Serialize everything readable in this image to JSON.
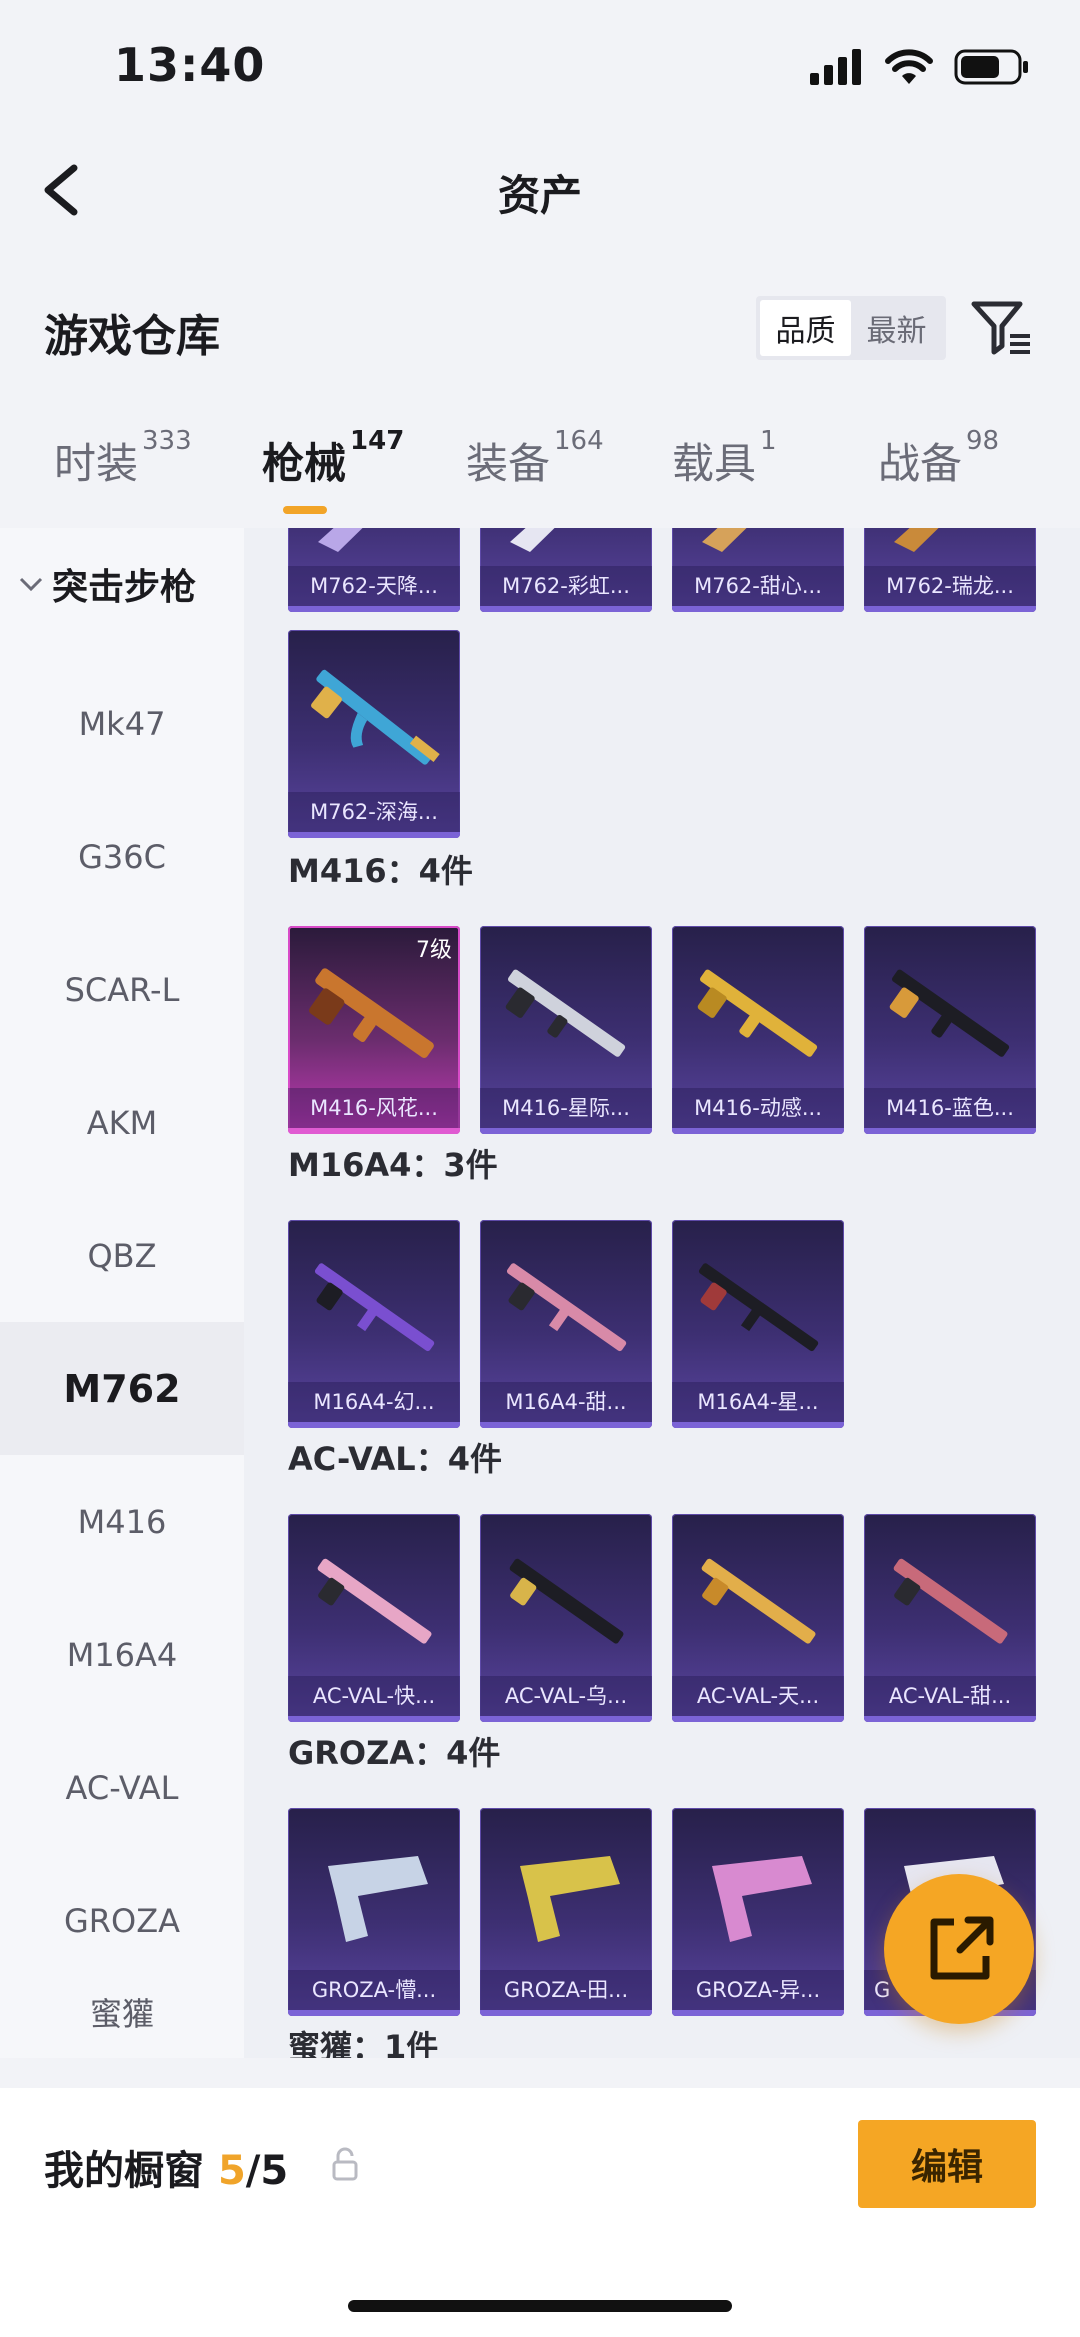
{
  "status_bar": {
    "time": "13:40"
  },
  "nav": {
    "title": "资产"
  },
  "header": {
    "section_title": "游戏仓库",
    "sort": {
      "quality": "品质",
      "newest": "最新"
    }
  },
  "tabs": [
    {
      "label": "时装",
      "count": "333"
    },
    {
      "label": "枪械",
      "count": "147"
    },
    {
      "label": "装备",
      "count": "164"
    },
    {
      "label": "载具",
      "count": "1"
    },
    {
      "label": "战备",
      "count": "98"
    }
  ],
  "sidebar": {
    "category": "突击步枪",
    "items": [
      "Mk47",
      "G36C",
      "SCAR-L",
      "AKM",
      "QBZ",
      "M762",
      "M416",
      "M16A4",
      "AC-VAL",
      "GROZA",
      "蜜獾"
    ],
    "active": "M762"
  },
  "content": {
    "m762_top": [
      "M762-天降...",
      "M762-彩虹...",
      "M762-甜心...",
      "M762-瑞龙..."
    ],
    "m762_extra": [
      "M762-深海..."
    ],
    "groups": [
      {
        "title": "M416：4件",
        "items": [
          "M416-风花...",
          "M416-星际...",
          "M416-动感...",
          "M416-蓝色..."
        ],
        "level_badge": "7级"
      },
      {
        "title": "M16A4：3件",
        "items": [
          "M16A4-幻...",
          "M16A4-甜...",
          "M16A4-星..."
        ]
      },
      {
        "title": "AC-VAL：4件",
        "items": [
          "AC-VAL-快...",
          "AC-VAL-乌...",
          "AC-VAL-天...",
          "AC-VAL-甜..."
        ]
      },
      {
        "title": "GROZA：4件",
        "items": [
          "GROZA-懵...",
          "GROZA-田...",
          "GROZA-异...",
          "G"
        ]
      }
    ],
    "next_group_title": "蜜獾：1件"
  },
  "bottom": {
    "window_label": "我的橱窗",
    "count": "5",
    "total": "/5",
    "edit": "编辑"
  },
  "colors": {
    "accent": "#f5a624",
    "card_purple": "#3d2f72",
    "card_gold": "#c23ab6"
  }
}
